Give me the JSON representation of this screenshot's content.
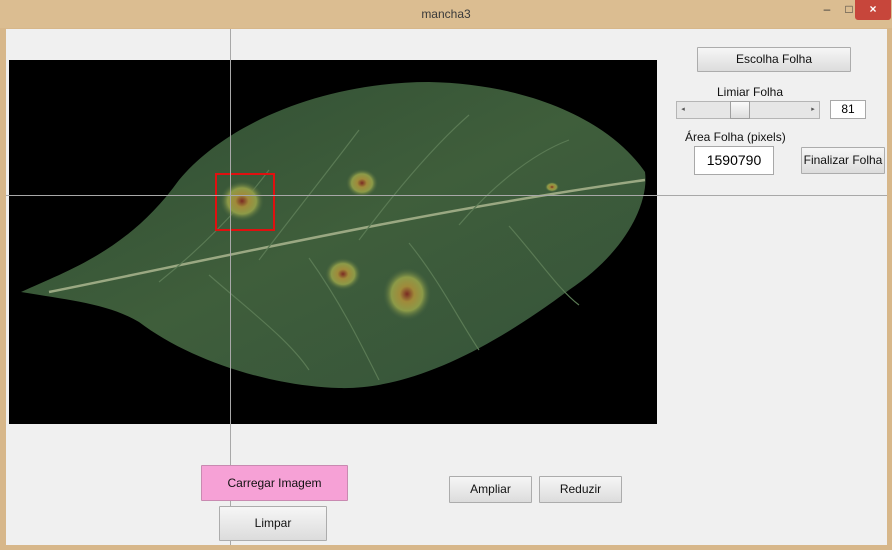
{
  "window": {
    "title": "mancha3",
    "min_glyph": "–",
    "max_glyph": "□",
    "close_glyph": "×"
  },
  "buttons": {
    "escolha_folha": "Escolha Folha",
    "finalizar_folha": "Finalizar Folha",
    "carregar_imagem": "Carregar Imagem",
    "limpar": "Limpar",
    "ampliar": "Ampliar",
    "reduzir": "Reduzir"
  },
  "limiar": {
    "label": "Limiar Folha",
    "value": "81",
    "left_arrow": "◂",
    "right_arrow": "▸"
  },
  "area": {
    "label": "Área Folha (pixels)",
    "value": "1590790"
  },
  "colors": {
    "carregar_bg": "#f6a1d6",
    "selection_box": "#e01010",
    "leaf": "#3e5a3c"
  }
}
